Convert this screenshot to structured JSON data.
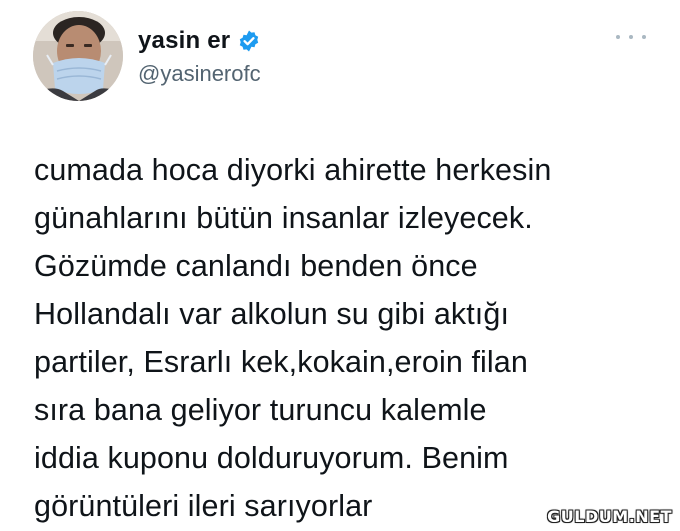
{
  "user": {
    "display_name": "yasin er",
    "handle": "@yasinerofc",
    "verified": true,
    "verified_color": "#1d9bf0"
  },
  "tweet": {
    "lines": [
      "cumada hoca diyorki ahirette herkesin",
      "günahlarını bütün insanlar izleyecek.",
      "Gözümde canlandı benden önce",
      "Hollandalı var alkolun su gibi aktığı",
      "partiler, Esrarlı kek,kokain,eroin filan",
      "sıra bana geliyor turuncu kalemle",
      "iddia kuponu dolduruyorum. Benim",
      "görüntüleri ileri sarıyorlar"
    ]
  },
  "icons": {
    "more": "more-horizontal-icon",
    "verified": "verified-badge-icon"
  },
  "watermark": {
    "text": "GULDUM.NET"
  }
}
